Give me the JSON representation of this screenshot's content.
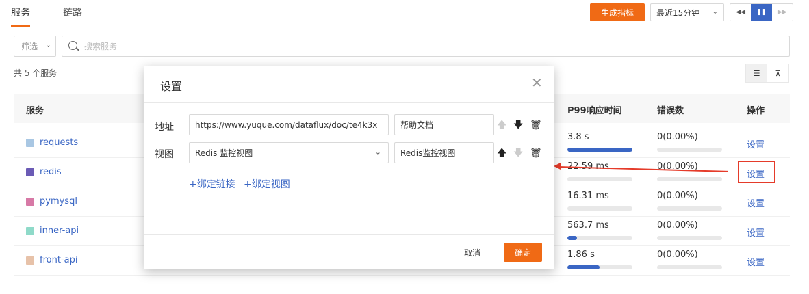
{
  "tabs": [
    {
      "label": "服务"
    },
    {
      "label": "链路"
    }
  ],
  "toolbar": {
    "generate_label": "生成指标",
    "time_range": "最近15分钟",
    "rewind_icon": "◀◀",
    "pause_icon": "❚❚",
    "forward_icon": "▶▶"
  },
  "filter": {
    "label": "筛选",
    "chevron": "⌄"
  },
  "search": {
    "placeholder": "搜索服务"
  },
  "summary": {
    "count_text": "共 5 个服务"
  },
  "view_toggle": {
    "list_icon": "☰",
    "topology_icon": "⊼"
  },
  "table": {
    "headers": {
      "service": "服务",
      "p99": "P99响应时间",
      "errors": "错误数",
      "action": "操作"
    },
    "rows": [
      {
        "name": "requests",
        "color": "#a9c7e3",
        "p99": "3.8 s",
        "p99_fraction": 1.0,
        "errors": "0(0.00%)",
        "action": "设置"
      },
      {
        "name": "redis",
        "color": "#6b5bb5",
        "p99": "22.59 ms",
        "p99_fraction": 0.0,
        "errors": "0(0.00%)",
        "action": "设置"
      },
      {
        "name": "pymysql",
        "color": "#d779a6",
        "p99": "16.31 ms",
        "p99_fraction": 0.0,
        "errors": "0(0.00%)",
        "action": "设置"
      },
      {
        "name": "inner-api",
        "color": "#8fdac9",
        "p99": "563.7 ms",
        "p99_fraction": 0.15,
        "errors": "0(0.00%)",
        "action": "设置"
      },
      {
        "name": "front-api",
        "color": "#e7c2a9",
        "p99": "1.86 s",
        "p99_fraction": 0.49,
        "errors": "0(0.00%)",
        "action": "设置"
      }
    ]
  },
  "modal": {
    "title": "设置",
    "close_icon": "✕",
    "address": {
      "label": "地址",
      "url": "https://www.yuque.com/dataflux/doc/te4k3x",
      "name": "帮助文档"
    },
    "view": {
      "label": "视图",
      "selected": "Redis 监控视图",
      "name": "Redis监控视图"
    },
    "icons": {
      "up": "🡅",
      "down": "🡇",
      "delete": "🗑"
    },
    "add_link": "+绑定链接",
    "add_view": "+绑定视图",
    "cancel": "取消",
    "ok": "确定"
  }
}
